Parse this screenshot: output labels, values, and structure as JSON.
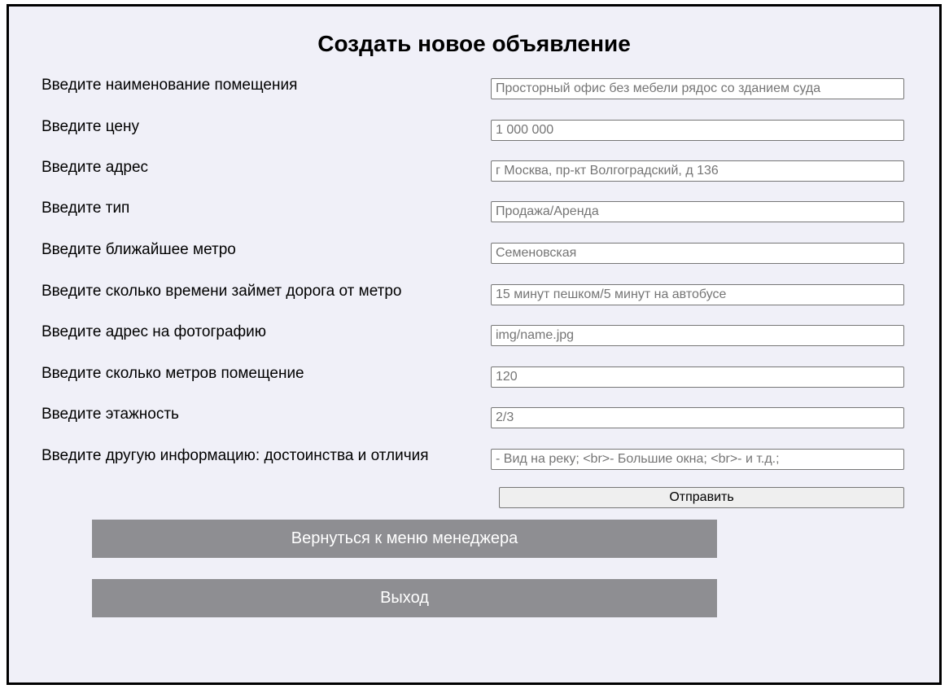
{
  "page": {
    "title": "Создать новое объявление"
  },
  "form": {
    "fields": [
      {
        "label": "Введите наименование помещения",
        "placeholder": "Просторный офис без мебели рядос со зданием суда",
        "value": ""
      },
      {
        "label": "Введите цену",
        "placeholder": "1 000 000",
        "value": ""
      },
      {
        "label": "Введите адрес",
        "placeholder": "г Москва, пр-кт Волгоградский, д 136",
        "value": ""
      },
      {
        "label": "Введите тип",
        "placeholder": "Продажа/Аренда",
        "value": ""
      },
      {
        "label": "Введите ближайшее метро",
        "placeholder": "Семеновская",
        "value": ""
      },
      {
        "label": "Введите сколько времени займет дорога от метро",
        "placeholder": "15 минут пешком/5 минут на автобусе",
        "value": ""
      },
      {
        "label": "Введите адрес на фотографию",
        "placeholder": "img/name.jpg",
        "value": ""
      },
      {
        "label": "Введите сколько метров помещение",
        "placeholder": "120",
        "value": ""
      },
      {
        "label": "Введите этажность",
        "placeholder": "2/3",
        "value": ""
      },
      {
        "label": "Введите другую информацию: достоинства и отличия",
        "placeholder": "- Вид на реку; <br>- Большие окна; <br>- и т.д.;",
        "value": ""
      }
    ],
    "submit_label": "Отправить"
  },
  "nav": {
    "back_label": "Вернуться к меню менеджера",
    "exit_label": "Выход"
  },
  "colors": {
    "page_background": "#f0f0f8",
    "nav_button_background": "#8e8e92",
    "nav_button_text": "#ffffff",
    "frame_border": "#000000"
  }
}
